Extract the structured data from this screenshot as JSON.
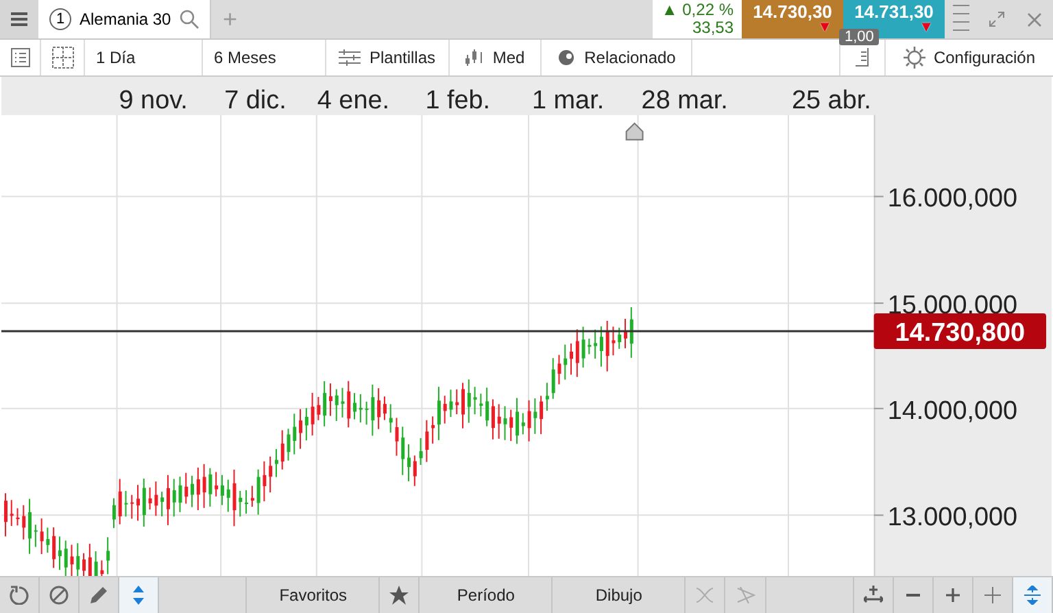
{
  "tabs": [
    {
      "number": "1",
      "label": "Alemania 30",
      "selected": true
    }
  ],
  "add_tab": "+",
  "quote": {
    "change_arrow": "▲",
    "change_percent": "0,22 %",
    "change_points": "33,53",
    "sell_price": "14.730,30",
    "sell_arrow": "▼",
    "buy_price": "14.731,30",
    "buy_arrow": "▼",
    "spread": "1,00"
  },
  "toolbar": {
    "interval": "1 Día",
    "range": "6 Meses",
    "templates": "Plantillas",
    "indicators": "Med",
    "related": "Relacionado",
    "settings": "Configuración"
  },
  "chart": {
    "x_labels": [
      "9 nov.",
      "7 dic.",
      "4 ene.",
      "1 feb.",
      "1 mar.",
      "28 mar.",
      "25 abr."
    ],
    "y_labels": [
      "16.000,000",
      "15.000,000",
      "14.000,000",
      "13.000,000"
    ],
    "current_price": "14.730,800"
  },
  "bottom_bar": {
    "favorites": "Favoritos",
    "period": "Período",
    "drawing": "Dibujo"
  }
}
